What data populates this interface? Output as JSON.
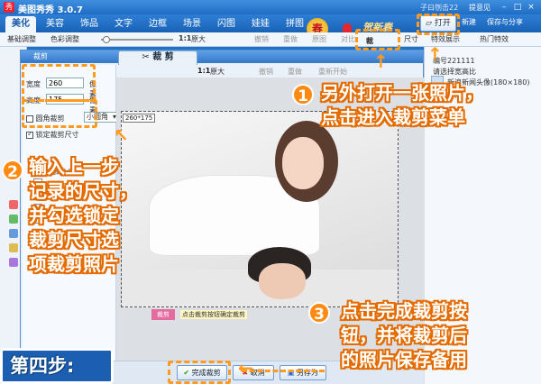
{
  "window": {
    "title": "美图秀秀 3.0.7",
    "user": "子曰刎击22",
    "feedback": "提意见",
    "controls": [
      "–",
      "□",
      "×"
    ]
  },
  "menu_tabs": [
    "美化",
    "美容",
    "饰品",
    "文字",
    "边框",
    "场景",
    "闪图",
    "娃娃",
    "拼图"
  ],
  "logo": {
    "glyph": "春",
    "text": "贺新春",
    "year": "2011"
  },
  "top_buttons": {
    "open": "打开",
    "new": "新建",
    "save_share": "保存与分享"
  },
  "toolbar": {
    "basic": "基础调整",
    "color": "色彩调整",
    "ratio": "1:1",
    "original": "原大",
    "undo": "撤销",
    "redo": "重做",
    "original_img": "原图",
    "compare": "对比",
    "crop": "裁剪",
    "size": "尺寸",
    "special": "特效展示",
    "hot": "热门特效"
  },
  "dialog": {
    "title": "裁剪",
    "tab": "裁 剪",
    "tools": {
      "ratio": "1:1",
      "original": "原大",
      "undo": "撤销",
      "redo": "重做",
      "reset": "重新开始"
    },
    "width_label": "宽度",
    "width_value": "260",
    "height_label": "高度",
    "height_value": "175",
    "unit": "像素",
    "round_corner": "圆角裁剪",
    "round_option": "小圆角",
    "lock_size": "锁定裁剪尺寸",
    "ratio_list_label": "请选择宽高比例",
    "dim_label": "260*175",
    "crop_tag": "裁剪",
    "crop_hint": "点击裁剪按钮确定裁剪",
    "finish": "完成裁剪",
    "cancel": "取消",
    "save_as": "另存为"
  },
  "right_panel": {
    "ratio_label": "请选择宽高比",
    "item1": "新浪新闻头像(180×180)",
    "item2": "腾讯新闻",
    "item3": "开心网",
    "id_text": "编号221111"
  },
  "annotations": {
    "step1": "1",
    "note1_line1": "另外打开一张照片，",
    "note1_line2": "点击进入裁剪菜单",
    "step2": "2",
    "note2_line1": "输入上一步",
    "note2_line2": "记录的尺寸，",
    "note2_line3": "并勾选锁定",
    "note2_line4": "裁剪尺寸选",
    "note2_line5": "项裁剪照片",
    "step3": "3",
    "note3_line1": "点击完成裁剪按",
    "note3_line2": "钮，并将裁剪后",
    "note3_line3": "的照片保存备用",
    "step4_label": "第四步:"
  },
  "colors": {
    "accent": "#ff9a1f",
    "frame": "#1f73c7"
  }
}
